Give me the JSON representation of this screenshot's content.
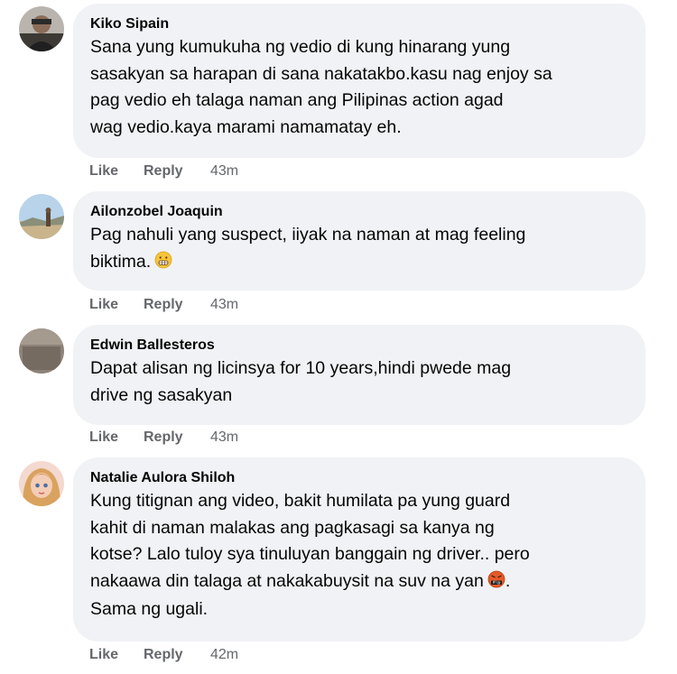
{
  "comments": [
    {
      "author": "Kiko Sipain",
      "text_lines": [
        "Sana yung kumukuha ng vedio di kung hinarang yung",
        "sasakyan sa harapan di sana nakatakbo.kasu nag enjoy sa",
        "pag vedio eh talaga naman ang Pilipinas action agad",
        "wag vedio.kaya marami namamatay eh."
      ],
      "actions": {
        "like": "Like",
        "reply": "Reply"
      },
      "time": "43m",
      "avatar_icon": "profile-photo-icon"
    },
    {
      "author": "Ailonzobel Joaquin",
      "text_lines": [
        "Pag nahuli yang suspect, iiyak na naman at mag feeling",
        "biktima."
      ],
      "emoji": "grimacing-face-emoji",
      "actions": {
        "like": "Like",
        "reply": "Reply"
      },
      "time": "43m",
      "avatar_icon": "profile-photo-icon"
    },
    {
      "author": "Edwin Ballesteros",
      "text_lines": [
        "Dapat alisan ng licinsya for 10 years,hindi pwede mag",
        "drive ng sasakyan"
      ],
      "actions": {
        "like": "Like",
        "reply": "Reply"
      },
      "time": "43m",
      "avatar_icon": "profile-photo-icon"
    },
    {
      "author": "Natalie Aulora Shiloh",
      "text_lines": [
        "Kung titignan ang video, bakit humilata pa yung guard",
        "kahit di naman malakas ang pagkasagi sa kanya ng",
        "kotse? Lalo tuloy sya tinuluyan banggain ng driver.. pero",
        "nakaawa din talaga at nakakabuysit na suv na yan",
        "Sama ng ugali."
      ],
      "line4_suffix": ".",
      "emoji": "cursing-face-emoji",
      "actions": {
        "like": "Like",
        "reply": "Reply"
      },
      "time": "42m",
      "avatar_icon": "profile-photo-icon"
    }
  ],
  "colors": {
    "bubble": "#f0f2f5",
    "text": "#050505",
    "secondary": "#65676b"
  }
}
